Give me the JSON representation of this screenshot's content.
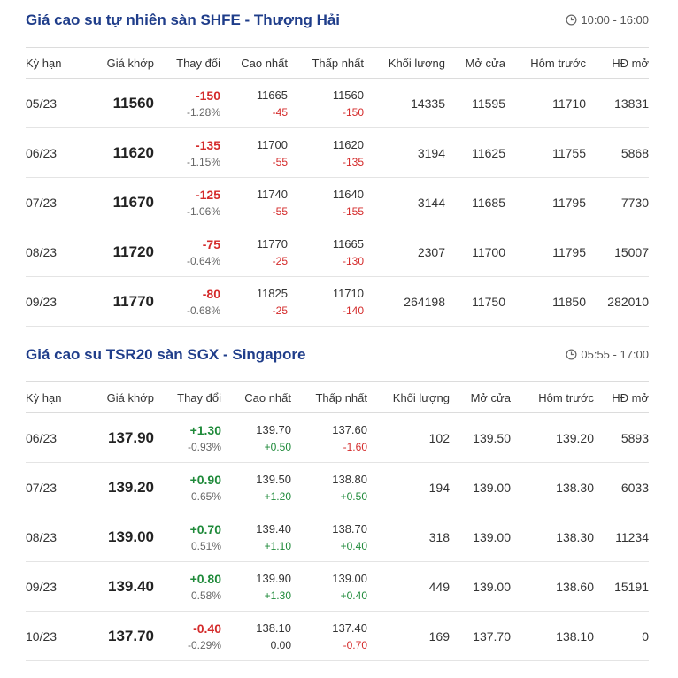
{
  "colors": {
    "title": "#1f3d8a",
    "negative": "#d42b2b",
    "positive": "#1f8a3a"
  },
  "headers": [
    "Kỳ hạn",
    "Giá khớp",
    "Thay đổi",
    "Cao nhất",
    "Thấp nhất",
    "Khối lượng",
    "Mở cửa",
    "Hôm trước",
    "HĐ mở"
  ],
  "sections": [
    {
      "title": "Giá cao su tự nhiên sàn SHFE - Thượng Hải",
      "time": "10:00 - 16:00",
      "time_icon": "clock-icon",
      "rows": [
        {
          "term": "05/23",
          "price": "11560",
          "change": "-150",
          "change_pct": "-1.28%",
          "change_dir": "neg",
          "high": "11665",
          "high_chg": "-45",
          "high_dir": "neg",
          "low": "11560",
          "low_chg": "-150",
          "low_dir": "neg",
          "volume": "14335",
          "open": "11595",
          "prev": "11710",
          "oi": "13831"
        },
        {
          "term": "06/23",
          "price": "11620",
          "change": "-135",
          "change_pct": "-1.15%",
          "change_dir": "neg",
          "high": "11700",
          "high_chg": "-55",
          "high_dir": "neg",
          "low": "11620",
          "low_chg": "-135",
          "low_dir": "neg",
          "volume": "3194",
          "open": "11625",
          "prev": "11755",
          "oi": "5868"
        },
        {
          "term": "07/23",
          "price": "11670",
          "change": "-125",
          "change_pct": "-1.06%",
          "change_dir": "neg",
          "high": "11740",
          "high_chg": "-55",
          "high_dir": "neg",
          "low": "11640",
          "low_chg": "-155",
          "low_dir": "neg",
          "volume": "3144",
          "open": "11685",
          "prev": "11795",
          "oi": "7730"
        },
        {
          "term": "08/23",
          "price": "11720",
          "change": "-75",
          "change_pct": "-0.64%",
          "change_dir": "neg",
          "high": "11770",
          "high_chg": "-25",
          "high_dir": "neg",
          "low": "11665",
          "low_chg": "-130",
          "low_dir": "neg",
          "volume": "2307",
          "open": "11700",
          "prev": "11795",
          "oi": "15007"
        },
        {
          "term": "09/23",
          "price": "11770",
          "change": "-80",
          "change_pct": "-0.68%",
          "change_dir": "neg",
          "high": "11825",
          "high_chg": "-25",
          "high_dir": "neg",
          "low": "11710",
          "low_chg": "-140",
          "low_dir": "neg",
          "volume": "264198",
          "open": "11750",
          "prev": "11850",
          "oi": "282010"
        }
      ]
    },
    {
      "title": "Giá cao su TSR20 sàn SGX - Singapore",
      "time": "05:55 - 17:00",
      "time_icon": "clock-icon",
      "rows": [
        {
          "term": "06/23",
          "price": "137.90",
          "change": "+1.30",
          "change_pct": "-0.93%",
          "change_dir": "pos",
          "high": "139.70",
          "high_chg": "+0.50",
          "high_dir": "pos",
          "low": "137.60",
          "low_chg": "-1.60",
          "low_dir": "neg",
          "volume": "102",
          "open": "139.50",
          "prev": "139.20",
          "oi": "5893"
        },
        {
          "term": "07/23",
          "price": "139.20",
          "change": "+0.90",
          "change_pct": "0.65%",
          "change_dir": "pos",
          "high": "139.50",
          "high_chg": "+1.20",
          "high_dir": "pos",
          "low": "138.80",
          "low_chg": "+0.50",
          "low_dir": "pos",
          "volume": "194",
          "open": "139.00",
          "prev": "138.30",
          "oi": "6033"
        },
        {
          "term": "08/23",
          "price": "139.00",
          "change": "+0.70",
          "change_pct": "0.51%",
          "change_dir": "pos",
          "high": "139.40",
          "high_chg": "+1.10",
          "high_dir": "pos",
          "low": "138.70",
          "low_chg": "+0.40",
          "low_dir": "pos",
          "volume": "318",
          "open": "139.00",
          "prev": "138.30",
          "oi": "11234"
        },
        {
          "term": "09/23",
          "price": "139.40",
          "change": "+0.80",
          "change_pct": "0.58%",
          "change_dir": "pos",
          "high": "139.90",
          "high_chg": "+1.30",
          "high_dir": "pos",
          "low": "139.00",
          "low_chg": "+0.40",
          "low_dir": "pos",
          "volume": "449",
          "open": "139.00",
          "prev": "138.60",
          "oi": "15191"
        },
        {
          "term": "10/23",
          "price": "137.70",
          "change": "-0.40",
          "change_pct": "-0.29%",
          "change_dir": "neg",
          "high": "138.10",
          "high_chg": "0.00",
          "high_dir": "zero",
          "low": "137.40",
          "low_chg": "-0.70",
          "low_dir": "neg",
          "volume": "169",
          "open": "137.70",
          "prev": "138.10",
          "oi": "0"
        }
      ]
    }
  ]
}
